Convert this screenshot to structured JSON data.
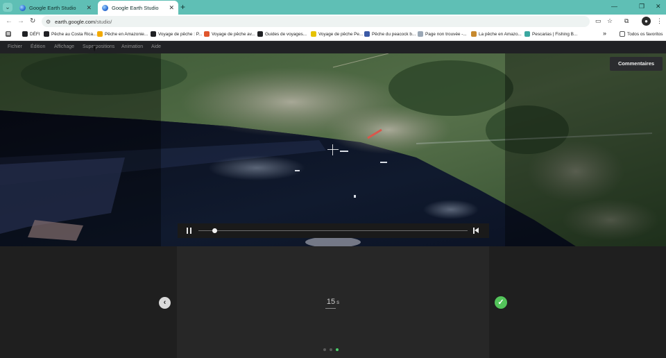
{
  "browser": {
    "tabs": [
      {
        "label": "Google Earth Studio",
        "active": false
      },
      {
        "label": "Google Earth Studio",
        "active": true
      }
    ],
    "address": {
      "host": "earth.google.com",
      "path": "/studio/"
    },
    "bookmarks": [
      {
        "label": "DÉFI",
        "color": "#202124"
      },
      {
        "label": "Pêche au Costa Rica...",
        "color": "#202124"
      },
      {
        "label": "Pêche en Amazonie...",
        "color": "#f2a900"
      },
      {
        "label": "Voyage de pêche : P...",
        "color": "#202124"
      },
      {
        "label": "Voyage de pêche av...",
        "color": "#e0562d"
      },
      {
        "label": "Guides de voyages...",
        "color": "#202124"
      },
      {
        "label": "Voyage de pêche Pe...",
        "color": "#e6c200"
      },
      {
        "label": "Pêche du peacock b...",
        "color": "#3b5aa6"
      },
      {
        "label": "Page non trouvée -...",
        "color": "#9aa7b5"
      },
      {
        "label": "La pêche en Amazo...",
        "color": "#c7892e"
      },
      {
        "label": "Pescarias | Fishing B...",
        "color": "#3aa7a0"
      }
    ],
    "bookmarks_more": "»",
    "all_bookmarks": "Todos os favoritos"
  },
  "app": {
    "menu": [
      "Fichier",
      "Édition",
      "Affichage",
      "Superpositions",
      "Animation",
      "Aide"
    ],
    "feedback_label": "Commentaires",
    "playback": {
      "progress": 0.06
    },
    "duration": {
      "value": "15",
      "unit": "s"
    },
    "steps": {
      "count": 3,
      "active": 2
    },
    "colors": {
      "accent_green": "#53c45a",
      "panel": "#272727",
      "menubar": "#202124",
      "tabstrip": "#5fbfb5"
    }
  }
}
